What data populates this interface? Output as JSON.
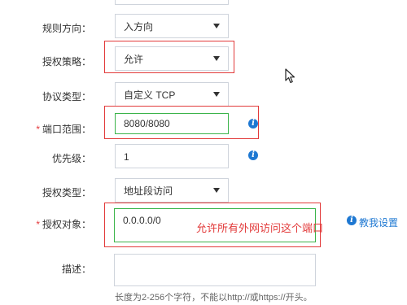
{
  "form": {
    "direction": {
      "label": "规则方向：",
      "value": "入方向"
    },
    "policy": {
      "label": "授权策略：",
      "value": "允许"
    },
    "protocol": {
      "label": "协议类型：",
      "value": "自定义 TCP"
    },
    "port_range": {
      "required_mark": "*",
      "label": "端口范围：",
      "value": "8080/8080"
    },
    "priority": {
      "label": "优先级：",
      "value": "1"
    },
    "auth_type": {
      "label": "授权类型：",
      "value": "地址段访问"
    },
    "auth_object": {
      "required_mark": "*",
      "label": "授权对象：",
      "value": "0.0.0.0/0"
    },
    "teach_link": "教我设置",
    "description": {
      "label": "描述：",
      "value": ""
    },
    "hint": "长度为2-256个字符，不能以http://或https://开头。"
  },
  "annotation": {
    "text": "允许所有外网访问这个端口"
  },
  "icons": {
    "info": "info-icon",
    "caret": "chevron-down-icon",
    "cursor": "mouse-cursor-icon"
  },
  "colors": {
    "annotation_red": "#e23a3a",
    "highlight_green": "#3bb44a",
    "info_blue": "#1e78d2"
  }
}
